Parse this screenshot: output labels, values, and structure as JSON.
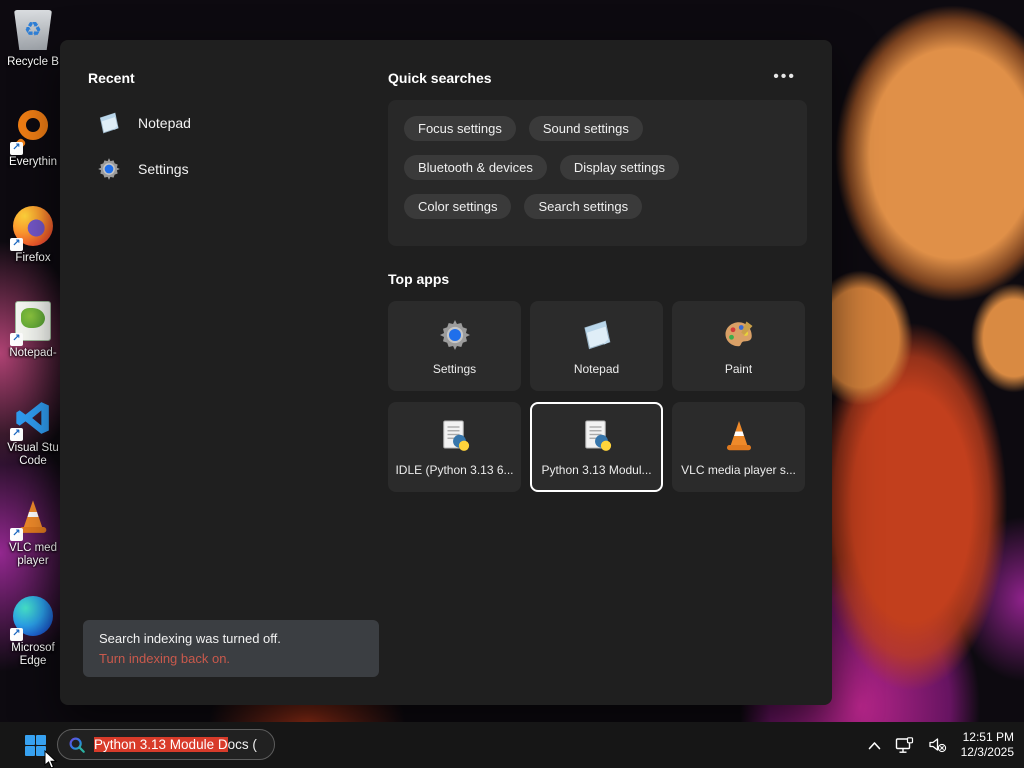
{
  "desktop": {
    "icons": [
      {
        "label": "Recycle B"
      },
      {
        "label": "Everythin"
      },
      {
        "label": "Firefox"
      },
      {
        "label": "Notepad-"
      },
      {
        "label": "Visual Stu Code"
      },
      {
        "label": "VLC med player"
      },
      {
        "label": "Microsof Edge"
      }
    ],
    "shortcut_glyph": "↗"
  },
  "search_panel": {
    "recent": {
      "header": "Recent",
      "items": [
        {
          "label": "Notepad"
        },
        {
          "label": "Settings"
        }
      ]
    },
    "quick_searches": {
      "header": "Quick searches",
      "more_label": "•••",
      "pills": [
        "Focus settings",
        "Sound settings",
        "Bluetooth & devices",
        "Display settings",
        "Color settings",
        "Search settings"
      ]
    },
    "top_apps": {
      "header": "Top apps",
      "tiles": [
        {
          "label": "Settings"
        },
        {
          "label": "Notepad"
        },
        {
          "label": "Paint"
        },
        {
          "label": "IDLE (Python 3.13 6..."
        },
        {
          "label": "Python 3.13 Modul..."
        },
        {
          "label": "VLC media player s..."
        }
      ]
    },
    "indexing_notice": {
      "line1": "Search indexing was turned off.",
      "line2": "Turn indexing back on."
    }
  },
  "taskbar": {
    "search_box": {
      "value_highlighted": "Python 3.13 Module D",
      "value_rest": "ocs ("
    },
    "tray": {
      "time": "12:51 PM",
      "date": "12/3/2025"
    }
  },
  "colors": {
    "selection_red": "#d83b2a",
    "notice_link_red": "#c9594c",
    "accent_blue": "#37a1f0"
  }
}
